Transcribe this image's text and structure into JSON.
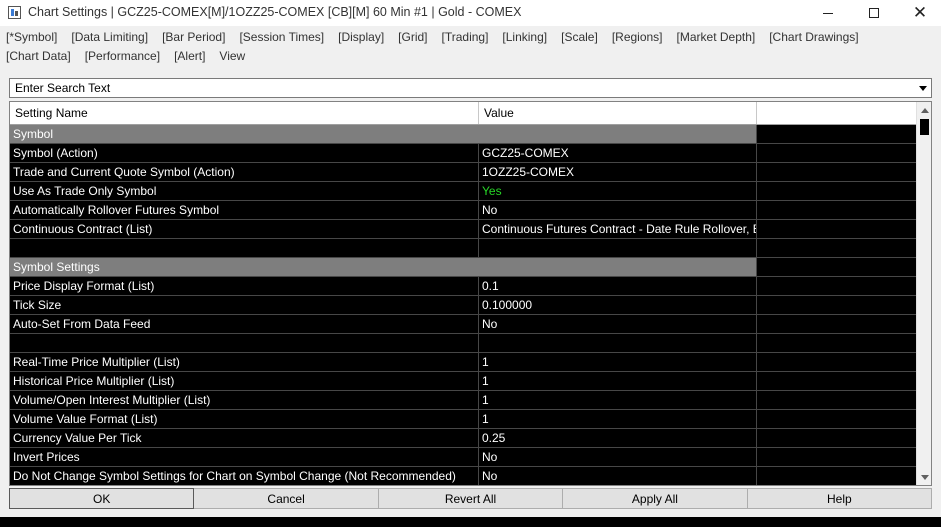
{
  "window": {
    "title": "Chart Settings | GCZ25-COMEX[M]/1OZZ25-COMEX [CB][M]  60 Min  #1 | Gold - COMEX",
    "minimize_glyph": "",
    "maximize_glyph": "",
    "close_glyph": "✕"
  },
  "tabs": {
    "row1": [
      "[*Symbol]",
      "[Data Limiting]",
      "[Bar Period]",
      "[Session Times]",
      "[Display]",
      "[Grid]",
      "[Trading]",
      "[Linking]",
      "[Scale]",
      "[Regions]",
      "[Market Depth]",
      "[Chart Drawings]"
    ],
    "row2": [
      "[Chart Data]",
      "[Performance]",
      "[Alert]",
      "View"
    ]
  },
  "search": {
    "placeholder": "Enter Search Text"
  },
  "grid": {
    "columns": [
      "Setting Name",
      "Value",
      ""
    ],
    "rows": [
      {
        "type": "section",
        "name": "Symbol",
        "value": ""
      },
      {
        "type": "setting",
        "name": "Symbol (Action)",
        "value": "GCZ25-COMEX"
      },
      {
        "type": "setting",
        "name": "Trade and Current Quote Symbol (Action)",
        "value": "1OZZ25-COMEX"
      },
      {
        "type": "setting",
        "name": "Use As Trade Only Symbol",
        "value": "Yes",
        "highlight": "green"
      },
      {
        "type": "setting",
        "name": "Automatically Rollover Futures Symbol",
        "value": "No"
      },
      {
        "type": "setting",
        "name": "Continuous Contract (List)",
        "value": "Continuous Futures Contract - Date Rule Rollover, B"
      },
      {
        "type": "blank",
        "name": "",
        "value": ""
      },
      {
        "type": "section",
        "name": "Symbol Settings",
        "value": ""
      },
      {
        "type": "setting",
        "name": "Price Display Format (List)",
        "value": "0.1"
      },
      {
        "type": "setting",
        "name": "Tick Size",
        "value": "0.100000"
      },
      {
        "type": "setting",
        "name": "Auto-Set From Data Feed",
        "value": "No"
      },
      {
        "type": "blank",
        "name": "",
        "value": ""
      },
      {
        "type": "setting",
        "name": "Real-Time Price Multiplier (List)",
        "value": "1"
      },
      {
        "type": "setting",
        "name": "Historical Price Multiplier (List)",
        "value": "1"
      },
      {
        "type": "setting",
        "name": "Volume/Open Interest Multiplier (List)",
        "value": "1"
      },
      {
        "type": "setting",
        "name": "Volume Value Format (List)",
        "value": "1"
      },
      {
        "type": "setting",
        "name": "Currency Value Per Tick",
        "value": "0.25"
      },
      {
        "type": "setting",
        "name": "Invert Prices",
        "value": "No"
      },
      {
        "type": "setting",
        "name": "Do Not Change Symbol Settings for Chart on Symbol Change (Not Recommended)",
        "value": "No"
      }
    ]
  },
  "buttons": {
    "ok": "OK",
    "cancel": "Cancel",
    "revert_all": "Revert All",
    "apply_all": "Apply All",
    "help": "Help"
  },
  "colors": {
    "grid_bg": "#000000",
    "section_bg": "#7e7e7e",
    "yes_green": "#27d627"
  }
}
